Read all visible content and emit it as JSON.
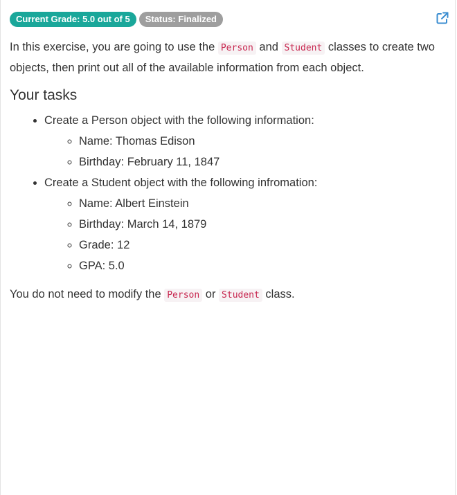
{
  "header": {
    "grade_badge": "Current Grade: 5.0 out of 5",
    "status_badge": "Status: Finalized",
    "external_link_icon": "external-link-icon",
    "accent_color": "#1aa79a",
    "link_color": "#3b8ed1"
  },
  "intro": {
    "part1": "In this exercise, you are going to use the ",
    "code1": "Person",
    "part2": " and ",
    "code2": "Student",
    "part3": " classes to create two objects, then print out all of the available information from each object."
  },
  "tasks": {
    "heading": "Your tasks",
    "items": [
      {
        "label": "Create a Person object with the following information:",
        "sub": [
          "Name: Thomas Edison",
          "Birthday: February 11, 1847"
        ]
      },
      {
        "label": "Create a Student object with the following infromation:",
        "sub": [
          "Name: Albert Einstein",
          "Birthday: March 14, 1879",
          "Grade: 12",
          "GPA: 5.0"
        ]
      }
    ]
  },
  "outro": {
    "part1": "You do not need to modify the ",
    "code1": "Person",
    "part2": " or ",
    "code2": "Student",
    "part3": " class."
  }
}
